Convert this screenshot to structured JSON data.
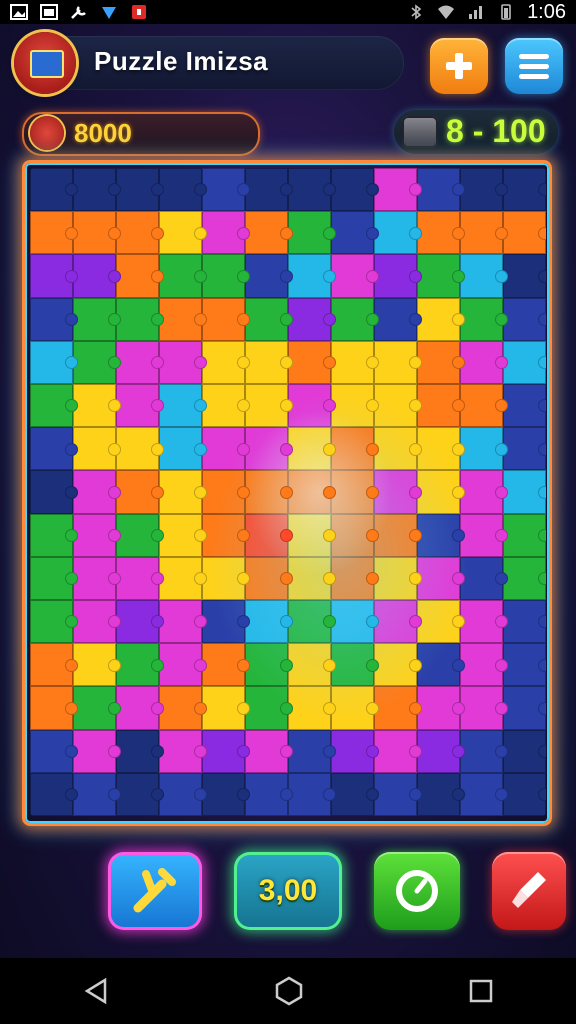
{
  "status_bar": {
    "time": "1:06",
    "left_icons": [
      "image-icon",
      "image-icon",
      "wrench-icon",
      "vpn-icon",
      "notification-icon"
    ],
    "right_icons": [
      "bluetooth-icon",
      "wifi-icon",
      "signal-icon",
      "battery-icon"
    ]
  },
  "header": {
    "title": "Puzzle Imizsa",
    "logo_icon": "badge-logo-icon",
    "plus_icon": "plus-icon",
    "menu_icon": "menu-icon"
  },
  "stats": {
    "coins": "8000",
    "coins_icon": "coin-icon",
    "moves": "8 - 100",
    "moves_icon": "cart-icon"
  },
  "board": {
    "columns": 12,
    "rows": 15,
    "colors": {
      "O": "#ff7a18",
      "B": "#2a3fa8",
      "N": "#1b2f7a",
      "G": "#25b53a",
      "Y": "#ffd21a",
      "M": "#e23ad6",
      "P": "#8a2be2",
      "C": "#24b8e8",
      "R": "#ff4a2a",
      "L": "#6ad83a"
    },
    "pattern": [
      "NNNNBNNNMBNN",
      "OOOYMOGBCOOO",
      "PPOGGBCMPGCN",
      "BGGOOGPGBYGB",
      "CGMMYYOYYOMC",
      "GYMCYYMYYOOB",
      "BYYCMMYOYYCB",
      "NMOYOOOOMYMC",
      "GMGYORYOOBMG",
      "GMMYYOYOYMBG",
      "GMPMBCGCMYMB",
      "OYGMOGYGYBMB",
      "OGMOYGYYOMMB",
      "BMNMPMBPMPBN",
      "NBNBNBBNBNBN"
    ]
  },
  "tools": {
    "hint_icon": "wrench-icon",
    "timer": "3,00",
    "clock_icon": "clock-icon",
    "eraser_icon": "eraser-icon"
  },
  "nav": {
    "back_icon": "back-triangle-icon",
    "home_icon": "home-circle-icon",
    "recents_icon": "recents-square-icon"
  }
}
